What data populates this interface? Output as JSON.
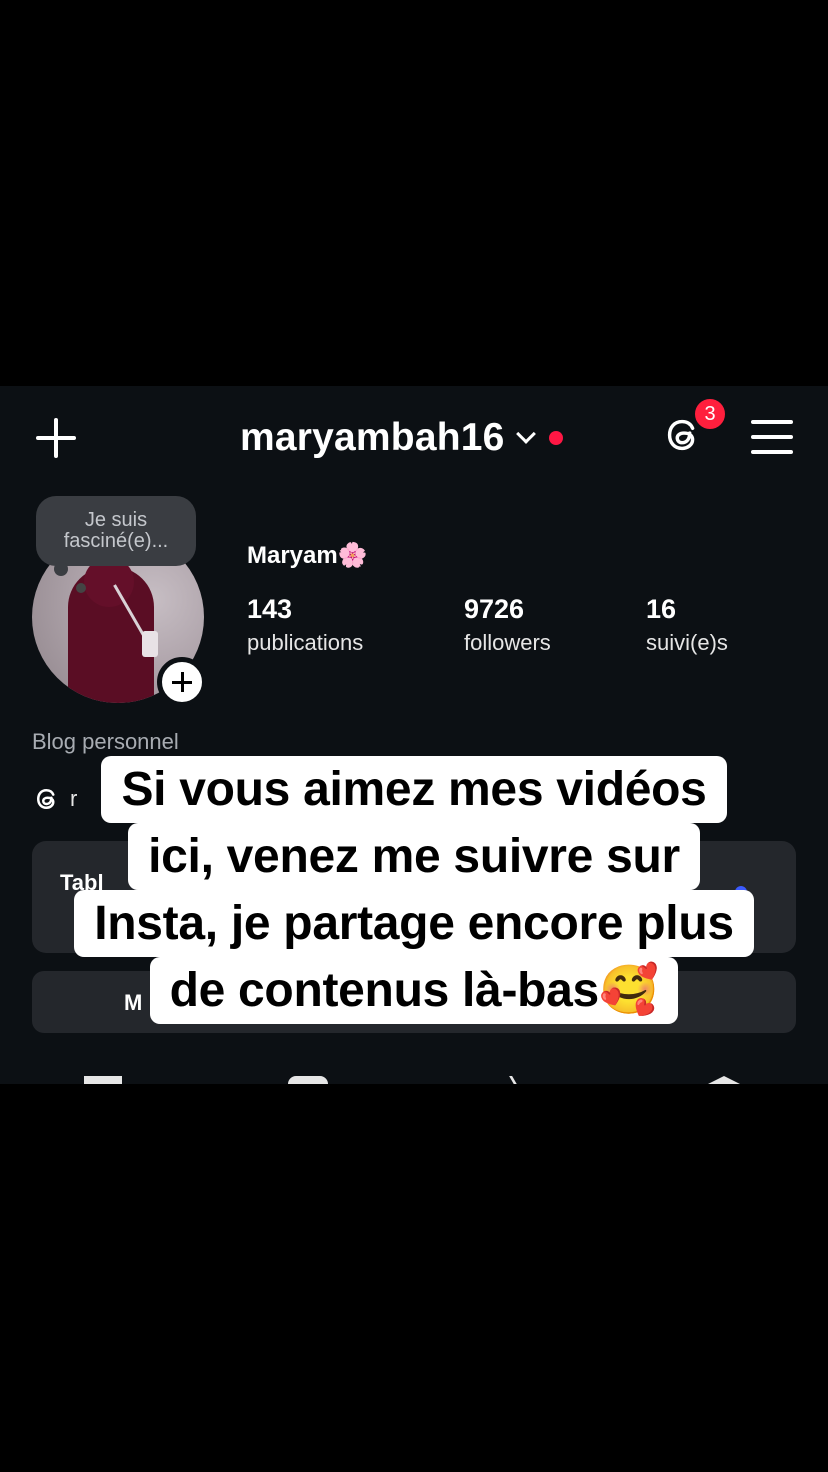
{
  "header": {
    "username": "maryambah16",
    "notification_count": "3",
    "threads_icon": "threads-icon",
    "menu_icon": "hamburger-menu-icon"
  },
  "profile": {
    "note": "Je suis fasciné(e)...",
    "display_name": "Maryam🌸",
    "stats": [
      {
        "value": "143",
        "label": "publications"
      },
      {
        "value": "9726",
        "label": "followers"
      },
      {
        "value": "16",
        "label": "suivi(e)s"
      }
    ],
    "category": "Blog personnel",
    "threads_link_text": "r",
    "dashboard_label": "Tabl",
    "button_label": "M"
  },
  "caption": {
    "lines": [
      "Si vous aimez mes vidéos",
      "ici, venez me suivre sur",
      "Insta, je partage encore plus",
      "de contenus là-bas🥰"
    ]
  },
  "colors": {
    "background": "#0c1014",
    "notification": "#ff1f3d",
    "online_dot": "#ff1744",
    "card": "#24272c"
  }
}
